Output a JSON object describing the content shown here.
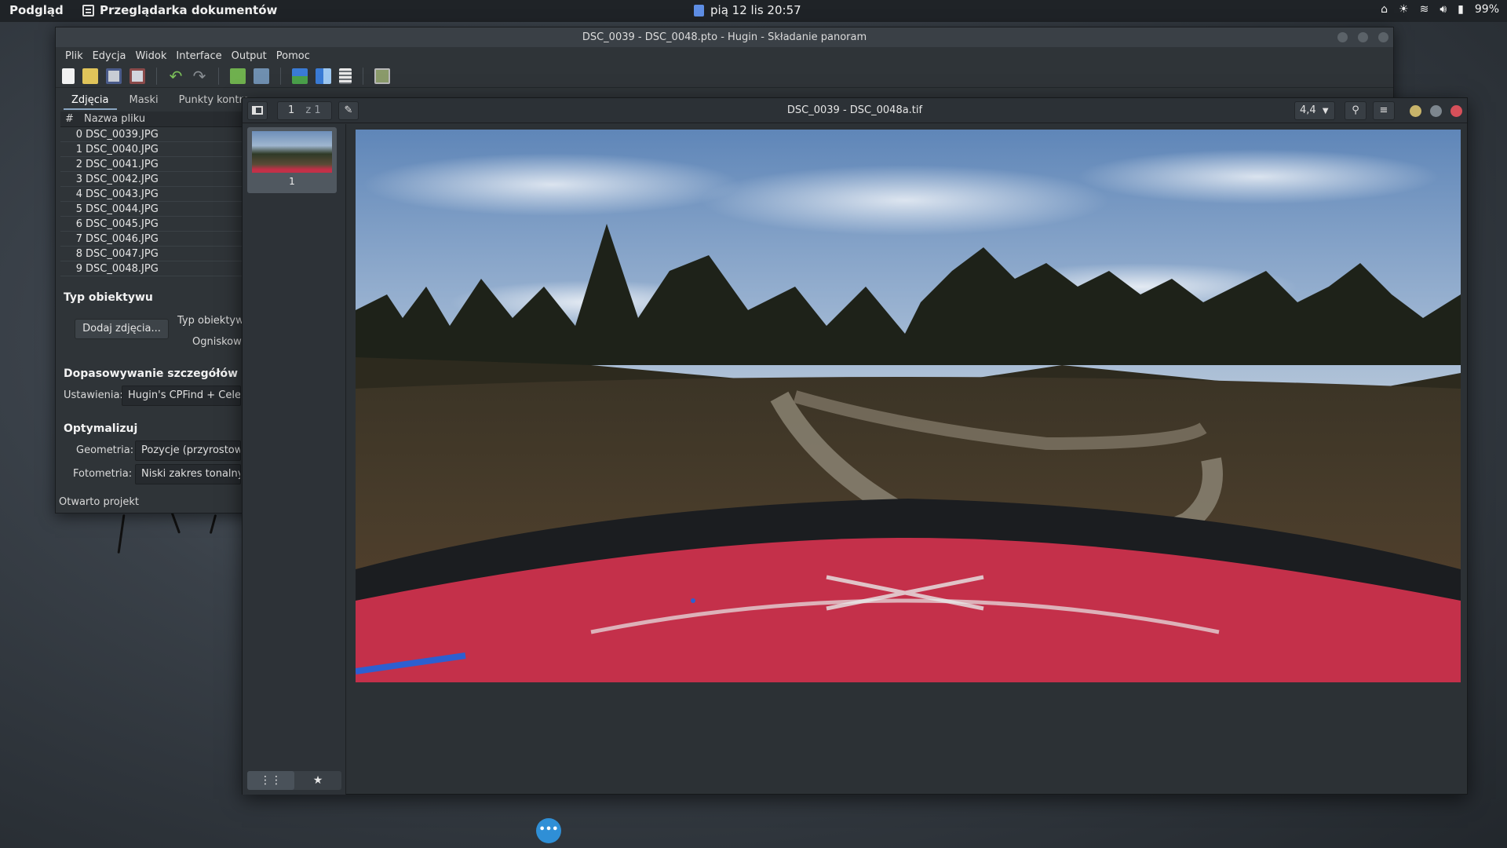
{
  "topbar": {
    "activities": "Podgląd",
    "app_name": "Przeglądarka dokumentów",
    "clock": "pią 12 lis  20:57",
    "battery": "99%"
  },
  "hugin": {
    "title": "DSC_0039 - DSC_0048.pto - Hugin - Składanie panoram",
    "menu": [
      "Plik",
      "Edycja",
      "Widok",
      "Interface",
      "Output",
      "Pomoc"
    ],
    "tabs": [
      "Zdjęcia",
      "Maski",
      "Punkty kontro"
    ],
    "table_headers": [
      "#",
      "Nazwa pliku"
    ],
    "files": [
      {
        "n": "0",
        "name": "DSC_0039.JPG"
      },
      {
        "n": "1",
        "name": "DSC_0040.JPG"
      },
      {
        "n": "2",
        "name": "DSC_0041.JPG"
      },
      {
        "n": "3",
        "name": "DSC_0042.JPG"
      },
      {
        "n": "4",
        "name": "DSC_0043.JPG"
      },
      {
        "n": "5",
        "name": "DSC_0044.JPG"
      },
      {
        "n": "6",
        "name": "DSC_0045.JPG"
      },
      {
        "n": "7",
        "name": "DSC_0046.JPG"
      },
      {
        "n": "8",
        "name": "DSC_0047.JPG"
      },
      {
        "n": "9",
        "name": "DSC_0048.JPG"
      }
    ],
    "lens_section": "Typ obiektywu",
    "add_images_button": "Dodaj zdjęcia...",
    "lens_type_label": "Typ obiektywu",
    "focal_label": "Ogniskowa",
    "matching_section": "Dopasowywanie szczegółów",
    "settings_label": "Ustawienia:",
    "settings_value": "Hugin's CPFind + Celeste",
    "optimize_section": "Optymalizuj",
    "geometry_label": "Geometria:",
    "geometry_value": "Pozycje (przyrostowo,",
    "photometry_label": "Fotometria:",
    "photometry_value": "Niski zakres tonalny",
    "status": "Otwarto projekt"
  },
  "viewer": {
    "title": "DSC_0039 - DSC_0048a.tif",
    "page_current": "1",
    "page_total": "z 1",
    "zoom": "4,4",
    "thumb_label": "1"
  }
}
